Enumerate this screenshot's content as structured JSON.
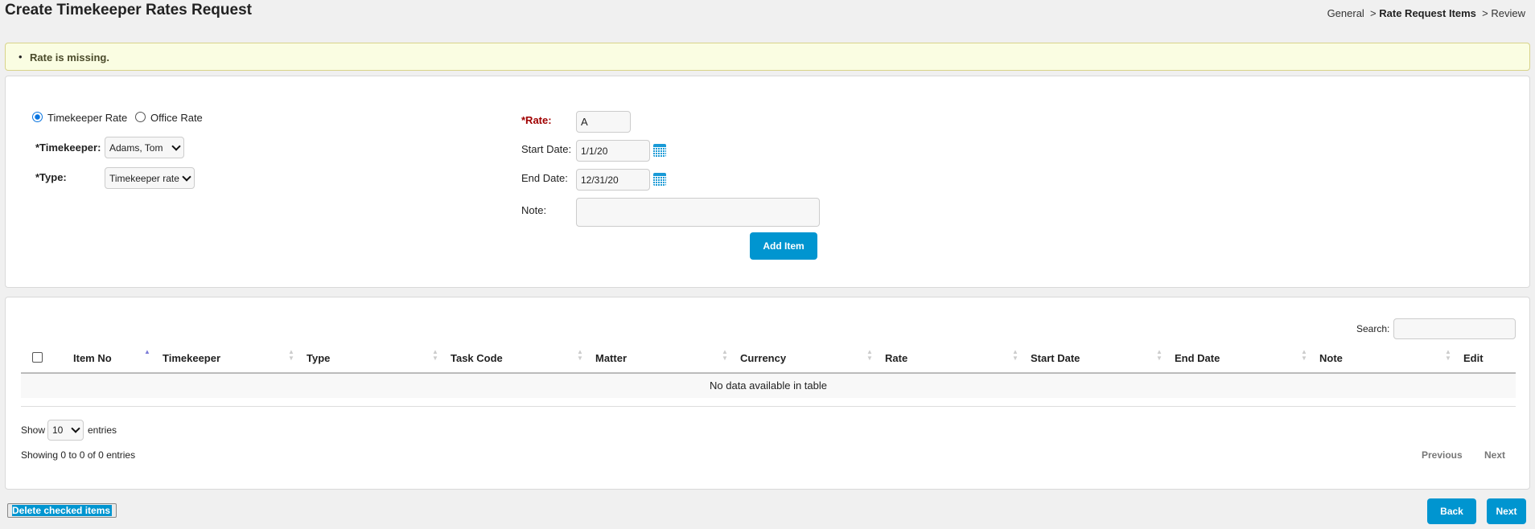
{
  "title": "Create Timekeeper Rates Request",
  "breadcrumb": {
    "step1": "General",
    "sep": ">",
    "step2": "Rate Request Items",
    "step3": "Review"
  },
  "alert": {
    "message": "Rate is missing."
  },
  "form": {
    "rate_kind": {
      "option1": "Timekeeper Rate",
      "option2": "Office Rate",
      "selected": "Timekeeper Rate"
    },
    "timekeeper_label": "*Timekeeper:",
    "timekeeper_value": "Adams, Tom",
    "type_label": "*Type:",
    "type_value": "Timekeeper rate",
    "rate_label": "*Rate:",
    "rate_value": "A",
    "start_label": "Start Date:",
    "start_value": "1/1/20",
    "end_label": "End Date:",
    "end_value": "12/31/20",
    "note_label": "Note:",
    "note_value": "",
    "add_label": "Add Item"
  },
  "table": {
    "search_label": "Search:",
    "search_value": "",
    "columns": [
      "Item No",
      "Timekeeper",
      "Type",
      "Task Code",
      "Matter",
      "Currency",
      "Rate",
      "Start Date",
      "End Date",
      "Note",
      "Edit"
    ],
    "sorted_column": "Item No",
    "empty": "No data available in table",
    "show_label": "Show",
    "page_size": "10",
    "entries_label": "entries",
    "info": "Showing 0 to 0 of 0 entries",
    "prev": "Previous",
    "next": "Next"
  },
  "footer": {
    "delete_label": "Delete checked items",
    "back_label": "Back",
    "next_label": "Next"
  },
  "colors": {
    "accent": "#0095d0",
    "alert_bg": "#fafde2",
    "required": "#a00000"
  }
}
